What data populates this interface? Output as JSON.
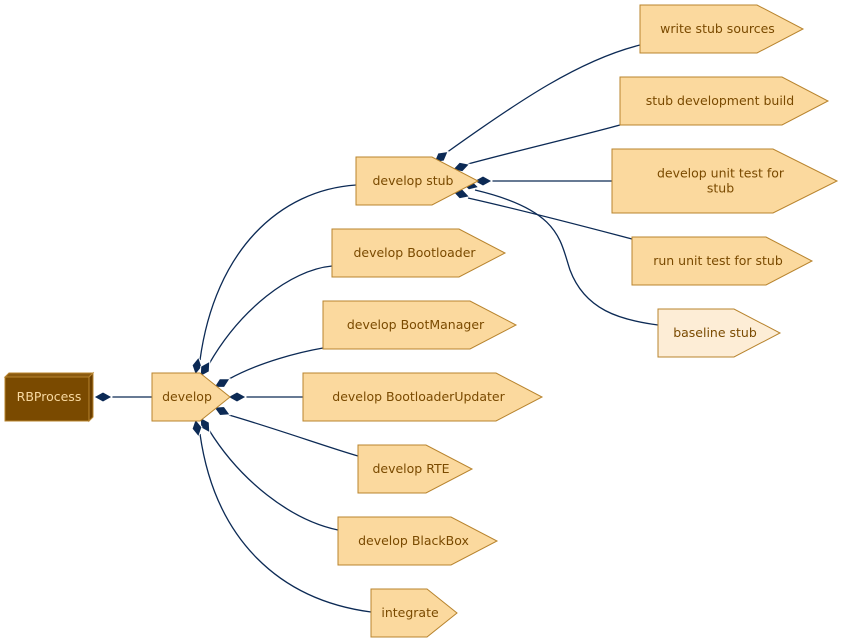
{
  "diagram": {
    "colors": {
      "node_fill": "#fbd99e",
      "node_fill_light": "#fdedd6",
      "node_stroke": "#b8842e",
      "root_fill": "#7a4a00",
      "root_text": "#f8d9a0",
      "text": "#7a4a00",
      "edge": "#0c2a55"
    },
    "root": {
      "id": "rbprocess",
      "label": "RBProcess"
    },
    "nodes": [
      {
        "id": "develop",
        "label": "develop",
        "style": "normal"
      },
      {
        "id": "develop-stub",
        "label": "develop stub",
        "style": "normal"
      },
      {
        "id": "write-stub-sources",
        "label": "write stub sources",
        "style": "normal"
      },
      {
        "id": "stub-development-build",
        "label": "stub development build",
        "style": "normal"
      },
      {
        "id": "develop-unit-test-for-stub",
        "label": "develop unit test for stub",
        "label_lines": [
          "develop unit test for",
          "stub"
        ],
        "style": "normal"
      },
      {
        "id": "run-unit-test-for-stub",
        "label": "run unit test for stub",
        "style": "normal"
      },
      {
        "id": "baseline-stub",
        "label": "baseline stub",
        "style": "light"
      },
      {
        "id": "develop-bootloader",
        "label": "develop Bootloader",
        "style": "normal"
      },
      {
        "id": "develop-bootmanager",
        "label": "develop BootManager",
        "style": "normal"
      },
      {
        "id": "develop-bootloaderupdater",
        "label": "develop BootloaderUpdater",
        "style": "normal"
      },
      {
        "id": "develop-rte",
        "label": "develop RTE",
        "style": "normal"
      },
      {
        "id": "develop-blackbox",
        "label": "develop BlackBox",
        "style": "normal"
      },
      {
        "id": "integrate",
        "label": "integrate",
        "style": "normal"
      }
    ],
    "edges": [
      {
        "from": "rbprocess",
        "to": "develop",
        "type": "composition"
      },
      {
        "from": "develop",
        "to": "develop-stub",
        "type": "composition"
      },
      {
        "from": "develop",
        "to": "develop-bootloader",
        "type": "composition"
      },
      {
        "from": "develop",
        "to": "develop-bootmanager",
        "type": "composition"
      },
      {
        "from": "develop",
        "to": "develop-bootloaderupdater",
        "type": "composition"
      },
      {
        "from": "develop",
        "to": "develop-rte",
        "type": "composition"
      },
      {
        "from": "develop",
        "to": "develop-blackbox",
        "type": "composition"
      },
      {
        "from": "develop",
        "to": "integrate",
        "type": "composition"
      },
      {
        "from": "develop-stub",
        "to": "write-stub-sources",
        "type": "composition"
      },
      {
        "from": "develop-stub",
        "to": "stub-development-build",
        "type": "composition"
      },
      {
        "from": "develop-stub",
        "to": "develop-unit-test-for-stub",
        "type": "composition"
      },
      {
        "from": "develop-stub",
        "to": "run-unit-test-for-stub",
        "type": "composition"
      },
      {
        "from": "develop-stub",
        "to": "baseline-stub",
        "type": "composition"
      }
    ]
  }
}
